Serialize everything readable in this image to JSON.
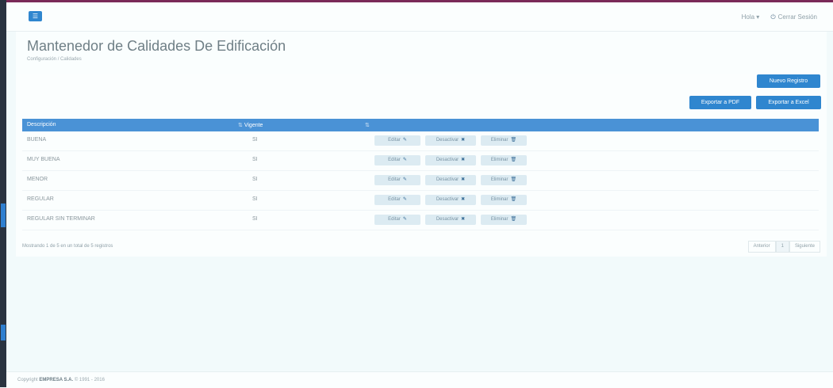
{
  "header": {
    "menu_icon": "bars-icon",
    "user_label": "Hola",
    "logout_label": "Cerrar Sesión"
  },
  "page": {
    "title": "Mantenedor de Calidades De Edificación",
    "breadcrumb": "Configuración / Calidades"
  },
  "toolbar": {
    "new_label": "Nuevo Registro",
    "pdf_label": "Exportar a PDF",
    "excel_label": "Exportar a Excel"
  },
  "table": {
    "columns": [
      "Descripción",
      "Vigente",
      ""
    ],
    "rows": [
      {
        "description": "BUENA",
        "vigente": "SI"
      },
      {
        "description": "MUY BUENA",
        "vigente": "SI"
      },
      {
        "description": "MENOR",
        "vigente": "SI"
      },
      {
        "description": "REGULAR",
        "vigente": "SI"
      },
      {
        "description": "REGULAR SIN TERMINAR",
        "vigente": "SI"
      }
    ],
    "actions": {
      "edit_label": "Editar",
      "disable_label": "Desactivar",
      "delete_label": "Eliminar"
    }
  },
  "footer_info": "Mostrando 1 de 5 en un total de 5 registros",
  "pager": {
    "prev": "Anterior",
    "current": "1",
    "next": "Siguiente"
  },
  "copyright": {
    "prefix": "Copyright",
    "company": "EMPRESA S.A.",
    "suffix": "© 1991 - 2016"
  },
  "colors": {
    "accent": "#2f86cf",
    "table_header": "#4a92d6",
    "sidebar": "#2a3340",
    "top_line": "#7a2a58"
  }
}
